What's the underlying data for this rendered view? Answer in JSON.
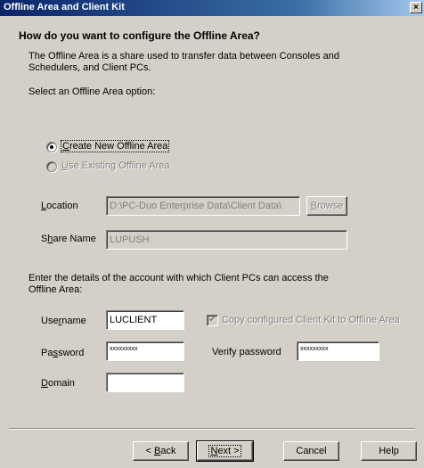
{
  "window": {
    "title": "Offline Area and Client Kit",
    "close_glyph": "×"
  },
  "heading": "How do you want to configure the Offline Area?",
  "description": "The Offline Area is a share used to transfer data between Consoles and Schedulers, and Client PCs.",
  "select_prompt": "Select an Offline Area option:",
  "options": {
    "create_new": {
      "label": "Create New Offline Area",
      "selected": true,
      "enabled": true
    },
    "use_existing": {
      "label": "Use Existing Offline Area",
      "selected": false,
      "enabled": false
    }
  },
  "location": {
    "label": "Location",
    "value": "D:\\PC-Duo Enterprise Data\\Client Data\\",
    "browse_label": "Browse"
  },
  "share_name": {
    "label": "Share Name",
    "value": "LUPUSH"
  },
  "account_prompt": "Enter the details of the account with which Client PCs can access the Offline Area:",
  "account": {
    "username_label": "Username",
    "username_value": "LUCLIENT",
    "password_label": "Password",
    "password_masked": "xxxxxxxxx",
    "verify_label": "Verify password",
    "verify_masked": "xxxxxxxxx",
    "domain_label": "Domain",
    "domain_value": "",
    "copy_kit_label": "Copy configured Client Kit to Offline Area",
    "copy_kit_checked": true
  },
  "buttons": {
    "back": "< Back",
    "next": "Next >",
    "cancel": "Cancel",
    "help": "Help"
  }
}
